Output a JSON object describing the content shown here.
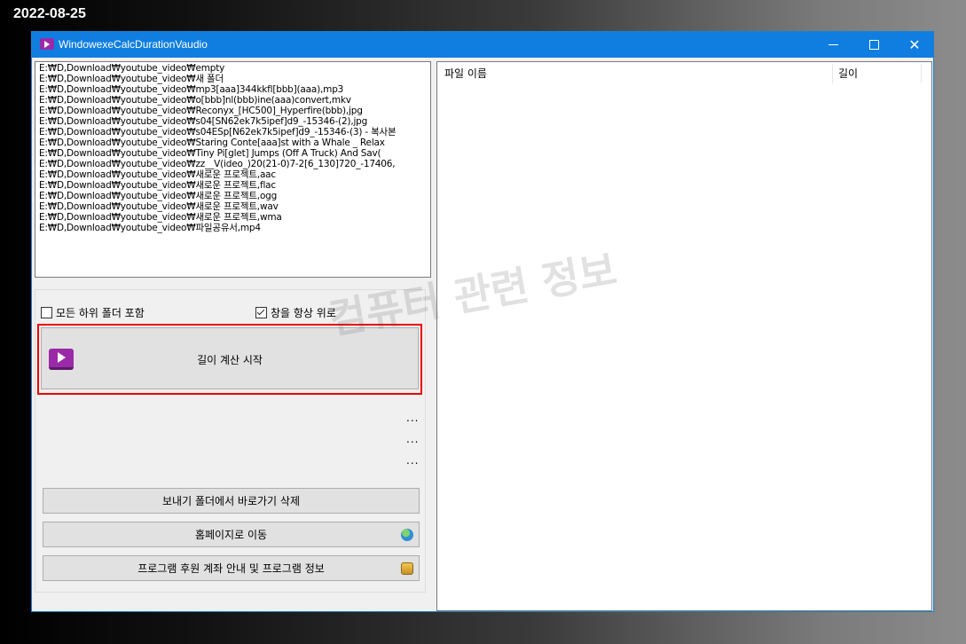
{
  "date_stamp": "2022-08-25",
  "window": {
    "title": "WindowexeCalcDurationVaudio",
    "minimize": "─",
    "maximize": "☐",
    "close": "✕"
  },
  "file_list": [
    "E:₩D,Download₩youtube_video₩empty",
    "E:₩D,Download₩youtube_video₩새 폴더",
    "E:₩D,Download₩youtube_video₩mp3[aaa]344kkfl[bbb](aaa),mp3",
    "E:₩D,Download₩youtube_video₩o[bbb]nl(bbb)ine(aaa)convert,mkv",
    "E:₩D,Download₩youtube_video₩Reconyx_[HC500]_Hyperfire(bbb),jpg",
    "E:₩D,Download₩youtube_video₩s04[SN62ek7k5ipef]d9_-15346-(2),jpg",
    "E:₩D,Download₩youtube_video₩s04ESp[N62ek7k5ipef]d9_-15346-(3) - 복사본",
    "E:₩D,Download₩youtube_video₩Staring Conte[aaa]st with a Whale _ Relax",
    "E:₩D,Download₩youtube_video₩Tiny Pi[glet] Jumps (Off A Truck) And Sav(",
    "E:₩D,Download₩youtube_video₩zz__V(ideo_)20(21-0)7-2[6_130]720_-17406,",
    "E:₩D,Download₩youtube_video₩새로운 프로젝트,aac",
    "E:₩D,Download₩youtube_video₩새로운 프로젝트,flac",
    "E:₩D,Download₩youtube_video₩새로운 프로젝트,ogg",
    "E:₩D,Download₩youtube_video₩새로운 프로젝트,wav",
    "E:₩D,Download₩youtube_video₩새로운 프로젝트,wma",
    "E:₩D,Download₩youtube_video₩파일공유서,mp4"
  ],
  "options": {
    "include_subfolders_label": "모든 하위 폴더 포함",
    "include_subfolders_checked": false,
    "always_on_top_label": "창을 항상 위로",
    "always_on_top_checked": true
  },
  "start_button": {
    "label": "길이 계산 시작",
    "icon": "video-play-icon"
  },
  "status_dots": [
    "...",
    "...",
    "..."
  ],
  "buttons": {
    "delete_shortcut": "보내기 폴더에서 바로가기 삭제",
    "homepage": "홈페이지로 이동",
    "homepage_icon": "globe-icon",
    "donate_info": "프로그램 후원 계좌 안내 및 프로그램 정보",
    "donate_icon": "coins-icon"
  },
  "result_table": {
    "columns": [
      "파일 이름",
      "길이"
    ]
  },
  "watermark": "컴퓨터 관련 정보",
  "colors": {
    "titlebar": "#0f7ee0",
    "highlight_border": "#e00000",
    "app_icon": "#9b2aa8"
  }
}
